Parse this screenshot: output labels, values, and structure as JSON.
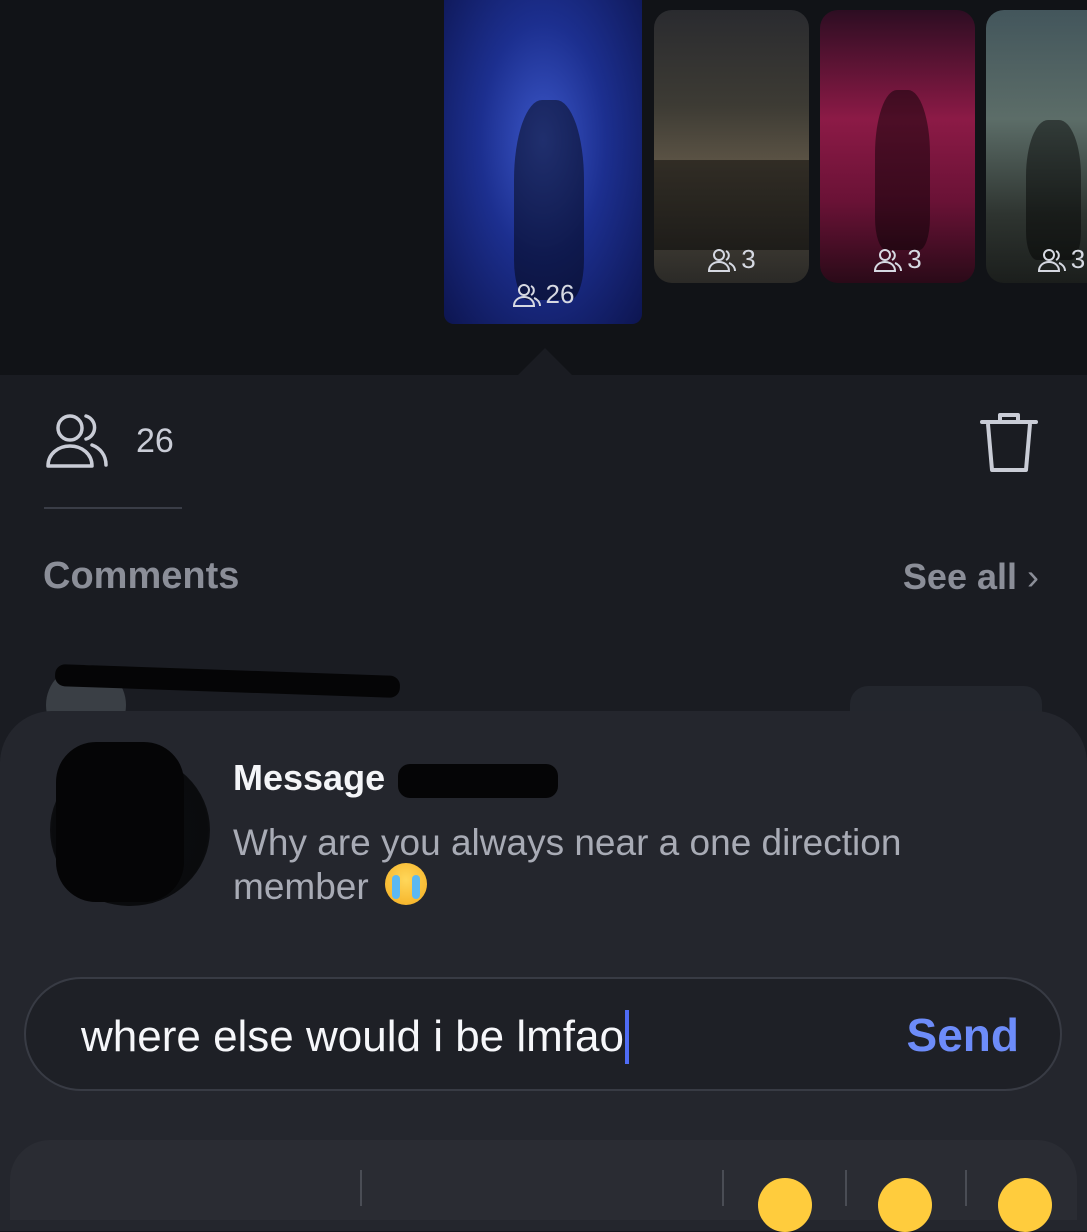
{
  "stories": [
    {
      "viewers": "26",
      "selected": true
    },
    {
      "viewers": "3",
      "selected": false
    },
    {
      "viewers": "3",
      "selected": false
    },
    {
      "viewers": "3",
      "selected": false
    }
  ],
  "stats": {
    "viewers_icon": "people-icon",
    "viewer_count": "26",
    "delete_icon": "trash-icon"
  },
  "comments": {
    "title": "Comments",
    "see_all": "See all",
    "chevron": "›"
  },
  "message": {
    "title": "Message",
    "body": "Why are you always near a one direction member",
    "emoji": "loudly-crying-face"
  },
  "composer": {
    "value": "where else would i be lmfao",
    "send_label": "Send"
  },
  "colors": {
    "accent": "#6d8cf9",
    "cursor": "#4f6cf5",
    "background": "#1a1c22",
    "sheet": "#24262d"
  }
}
